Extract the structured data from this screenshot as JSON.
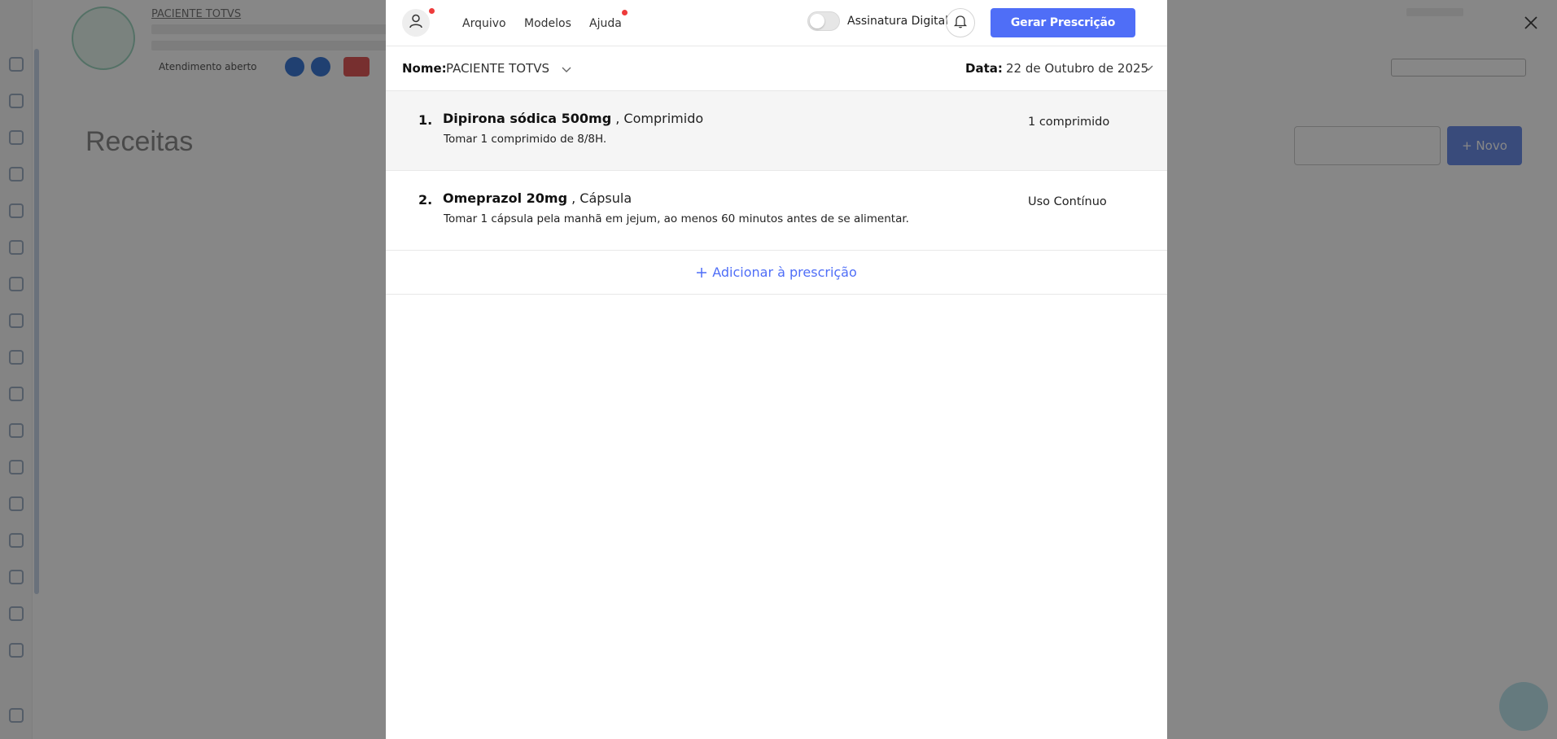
{
  "background": {
    "patient_name": "PACIENTE TOTVS",
    "attendance_status": "Atendimento aberto",
    "page_title": "Receitas",
    "new_button": "+ Novo"
  },
  "modal": {
    "menu": {
      "file": "Arquivo",
      "models": "Modelos",
      "help": "Ajuda"
    },
    "digital_signature_label": "Assinatura Digital",
    "digital_signature_enabled": false,
    "generate_button": "Gerar Prescrição",
    "name_label": "Nome:",
    "name_value": "PACIENTE TOTVS",
    "date_label": "Data:",
    "date_value": "22 de Outubro de 2025",
    "items": [
      {
        "number": "1.",
        "drug": "Dipirona sódica 500mg",
        "form": " , Comprimido",
        "instructions": "Tomar 1 comprimido de 8/8H.",
        "quantity": "1 comprimido"
      },
      {
        "number": "2.",
        "drug": "Omeprazol 20mg",
        "form": " , Cápsula",
        "instructions": "Tomar 1 cápsula pela manhã em jejum, ao menos 60 minutos antes de se alimentar.",
        "quantity": "Uso Contínuo"
      }
    ],
    "add_label": "Adicionar à prescrição"
  },
  "colors": {
    "primary": "#4f6ef7",
    "notification_dot": "#ee3b3b",
    "overlay": "rgba(0,0,0,0.47)"
  },
  "icons": {
    "user": "user-icon",
    "bell": "bell-icon",
    "chevron": "chevron-down-icon",
    "close": "close-icon",
    "plus": "plus-icon"
  }
}
